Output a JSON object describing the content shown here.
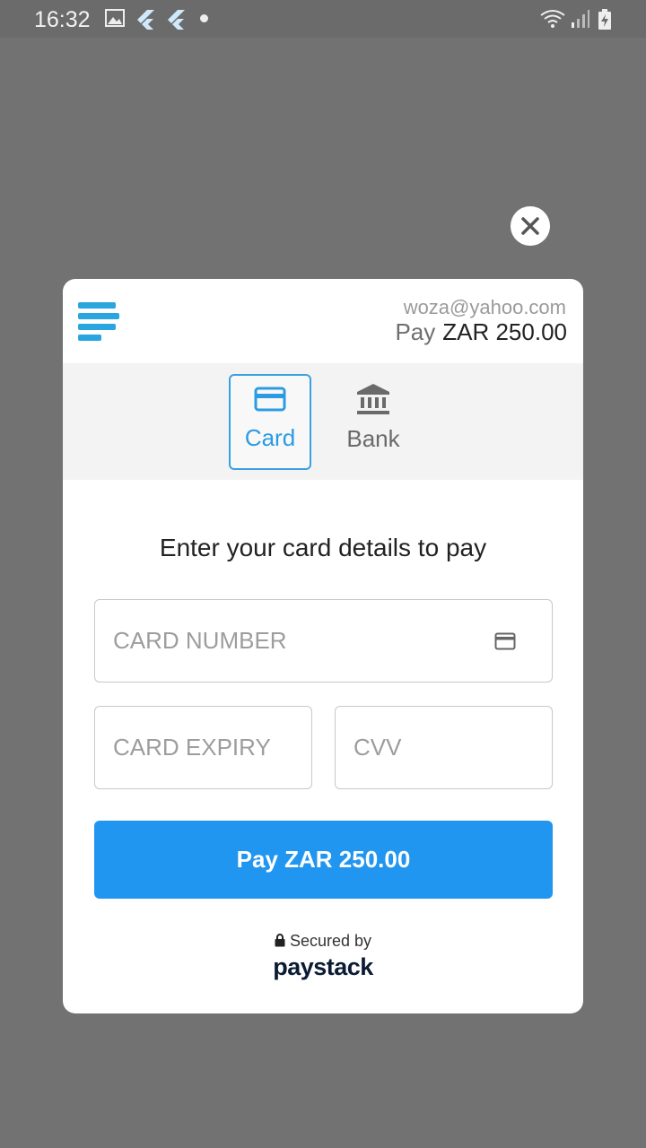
{
  "status_bar": {
    "time": "16:32",
    "icons": [
      "image-icon",
      "flutter-icon",
      "flutter-icon",
      "notification-dot",
      "wifi-icon",
      "signal-icon",
      "battery-charging-icon"
    ]
  },
  "checkout": {
    "email": "woza@yahoo.com",
    "pay_label": "Pay",
    "amount": "ZAR 250.00",
    "tabs": [
      {
        "label": "Card",
        "icon": "credit-card-icon",
        "selected": true
      },
      {
        "label": "Bank",
        "icon": "bank-icon",
        "selected": false
      }
    ],
    "heading": "Enter your card details to pay",
    "fields": {
      "card_number_placeholder": "CARD NUMBER",
      "card_expiry_placeholder": "CARD EXPIRY",
      "cvv_placeholder": "CVV"
    },
    "pay_button": "Pay ZAR 250.00",
    "secured_by": "Secured by",
    "brand": "paystack"
  },
  "colors": {
    "accent": "#2196f0",
    "tab_selected": "#3aa1e0",
    "logo": "#29a5e0",
    "overlay": "#727272"
  }
}
